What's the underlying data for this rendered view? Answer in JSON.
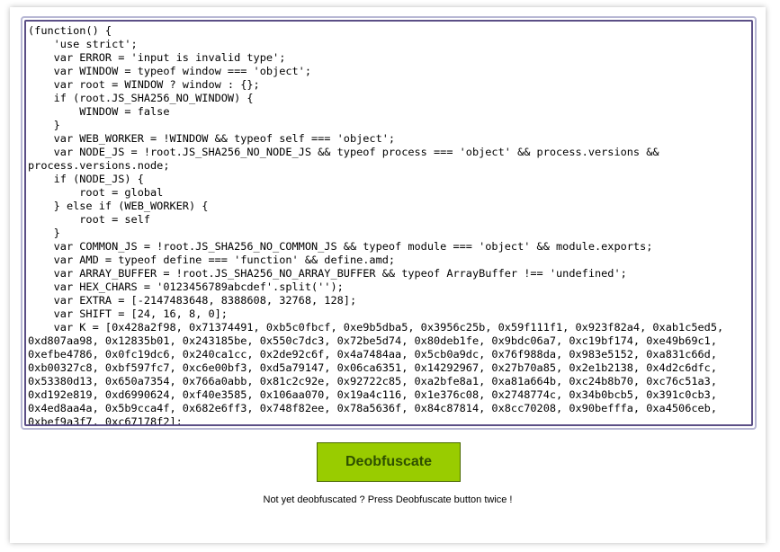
{
  "editor": {
    "lines": [
      "(function() {",
      "    'use strict';",
      "    var ERROR = 'input is invalid type';",
      "    var WINDOW = typeof window === 'object';",
      "    var root = WINDOW ? window : {};",
      "    if (root.JS_SHA256_NO_WINDOW) {",
      "        WINDOW = false",
      "    }",
      "    var WEB_WORKER = !WINDOW && typeof self === 'object';",
      "    var NODE_JS = !root.JS_SHA256_NO_NODE_JS && typeof process === 'object' && process.versions &&",
      "process.versions.node;",
      "    if (NODE_JS) {",
      "        root = global",
      "    } else if (WEB_WORKER) {",
      "        root = self",
      "    }",
      "    var COMMON_JS = !root.JS_SHA256_NO_COMMON_JS && typeof module === 'object' && module.exports;",
      "    var AMD = typeof define === 'function' && define.amd;",
      "    var ARRAY_BUFFER = !root.JS_SHA256_NO_ARRAY_BUFFER && typeof ArrayBuffer !== 'undefined';",
      "    var HEX_CHARS = '0123456789abcdef'.split('');",
      "    var EXTRA = [-2147483648, 8388608, 32768, 128];",
      "    var SHIFT = [24, 16, 8, 0];",
      "    var K = [0x428a2f98, 0x71374491, 0xb5c0fbcf, 0xe9b5dba5, 0x3956c25b, 0x59f111f1, 0x923f82a4, 0xab1c5ed5,",
      "0xd807aa98, 0x12835b01, 0x243185be, 0x550c7dc3, 0x72be5d74, 0x80deb1fe, 0x9bdc06a7, 0xc19bf174, 0xe49b69c1,",
      "0xefbe4786, 0x0fc19dc6, 0x240ca1cc, 0x2de92c6f, 0x4a7484aa, 0x5cb0a9dc, 0x76f988da, 0x983e5152, 0xa831c66d,",
      "0xb00327c8, 0xbf597fc7, 0xc6e00bf3, 0xd5a79147, 0x06ca6351, 0x14292967, 0x27b70a85, 0x2e1b2138, 0x4d2c6dfc,",
      "0x53380d13, 0x650a7354, 0x766a0abb, 0x81c2c92e, 0x92722c85, 0xa2bfe8a1, 0xa81a664b, 0xc24b8b70, 0xc76c51a3,",
      "0xd192e819, 0xd6990624, 0xf40e3585, 0x106aa070, 0x19a4c116, 0x1e376c08, 0x2748774c, 0x34b0bcb5, 0x391c0cb3,",
      "0x4ed8aa4a, 0x5b9cca4f, 0x682e6ff3, 0x748f82ee, 0x78a5636f, 0x84c87814, 0x8cc70208, 0x90befffa, 0xa4506ceb,",
      "0xbef9a3f7, 0xc67178f2];"
    ]
  },
  "deobfuscate_button": {
    "label": "Deobfuscate"
  },
  "status": {
    "text": "Not yet deobfuscated ? Press Deobfuscate button twice !"
  },
  "colors": {
    "button_bg": "#99cc00",
    "editor_border": "#5b4f86",
    "spellcheck_underline": "#d40000"
  }
}
